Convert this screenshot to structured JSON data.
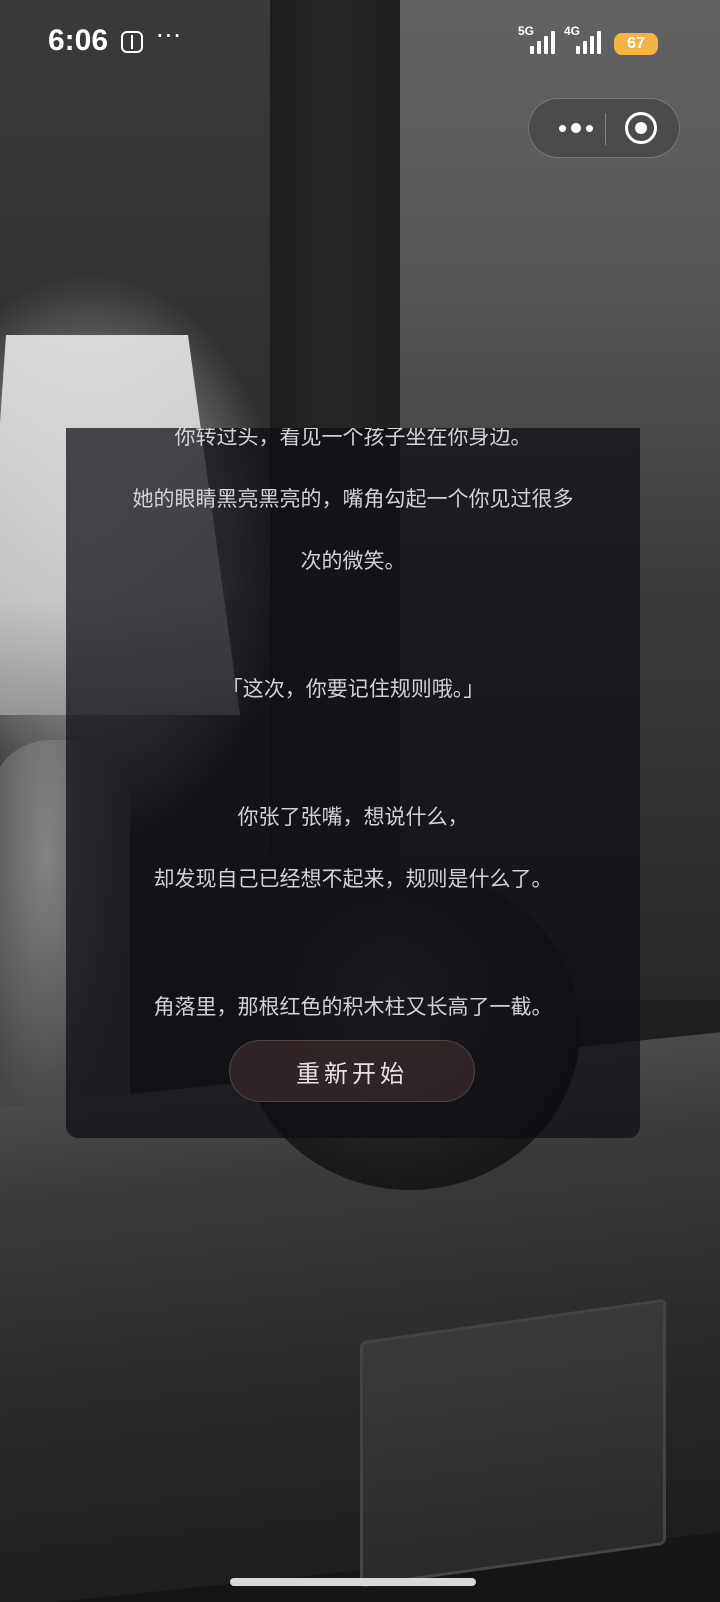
{
  "status_bar": {
    "time": "6:06",
    "more_dots": "···",
    "signal_1_label": "5G",
    "signal_2_label": "4G",
    "battery": "67",
    "battery_color": "#f4b342"
  },
  "capsule": {
    "more_icon": "more-dots-icon",
    "close_icon": "target-close-icon"
  },
  "story": {
    "lines": [
      "你转过头，看见一个孩子坐在你身边。",
      "她的眼睛黑亮黑亮的，嘴角勾起一个你见过很多",
      "次的微笑。",
      "「这次，你要记住规则哦。」",
      "你张了张嘴，想说什么，",
      "却发现自己已经想不起来，规则是什么了。",
      "角落里，那根红色的积木柱又长高了一截。"
    ],
    "restart_label": "重新开始"
  }
}
